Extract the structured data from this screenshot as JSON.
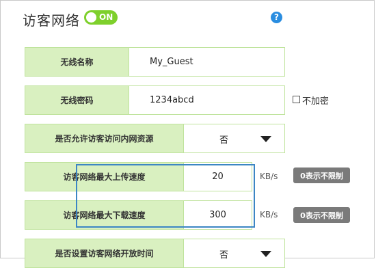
{
  "header": {
    "title": "访客网络",
    "toggle_label": "ON",
    "help_glyph": "?"
  },
  "form": {
    "ssid": {
      "label": "无线名称",
      "value": "My_Guest"
    },
    "password": {
      "label": "无线密码",
      "value": "1234abcd",
      "no_encrypt_label": "不加密"
    },
    "allow_internal": {
      "label": "是否允许访客访问内网资源",
      "value": "否"
    },
    "upload": {
      "label": "访客网络最大上传速度",
      "value": "20",
      "unit": "KB/s",
      "hint": "0表示不限制"
    },
    "download": {
      "label": "访客网络最大下载速度",
      "value": "300",
      "unit": "KB/s",
      "hint": "0表示不限制"
    },
    "schedule": {
      "label": "是否设置访客网络开放时间",
      "value": "否"
    }
  },
  "colors": {
    "toggle_on": "#7ed02c",
    "label_bg": "#d9f0c0",
    "highlight_border": "#3c86c4",
    "help_icon": "#2a8de0",
    "hint_badge": "#7a7a7a"
  }
}
